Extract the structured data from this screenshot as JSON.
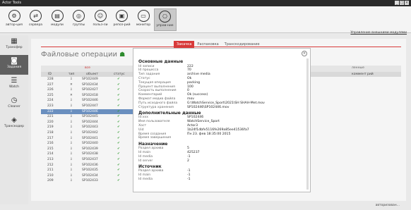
{
  "window": {
    "title": "Actor Tools",
    "controls": [
      "_",
      "□",
      "×"
    ]
  },
  "toolbar": {
    "items": [
      {
        "label": "автор-ция",
        "icon": "wrench-icon",
        "glyph": "⚙"
      },
      {
        "label": "сервера",
        "icon": "server-icon",
        "glyph": "⇄"
      },
      {
        "label": "модули",
        "icon": "modules-icon",
        "glyph": "▤"
      },
      {
        "label": "группы",
        "icon": "groups-icon",
        "glyph": "◎"
      },
      {
        "label": "польз-ли",
        "icon": "users-icon",
        "glyph": "☺"
      },
      {
        "label": "репоз-рий",
        "icon": "repository-icon",
        "glyph": "▣"
      },
      {
        "label": "монитор",
        "icon": "monitor-icon",
        "glyph": "▭"
      },
      {
        "label": "управ-ние",
        "icon": "control-icon",
        "glyph": "⎔"
      }
    ],
    "mgmt_link": "Управление внешними модулями"
  },
  "sidebar": {
    "items": [
      {
        "label": "Трансфер",
        "glyph": "▦"
      },
      {
        "label": "Задания",
        "glyph": "◙"
      },
      {
        "label": "Watch",
        "glyph": "☰"
      },
      {
        "label": "Cleaner",
        "glyph": "◷"
      },
      {
        "label": "Транскодер",
        "glyph": "◈"
      }
    ]
  },
  "main": {
    "title": "Файловые операции",
    "tabs": [
      "Закачка",
      "Распаковка",
      "Транскодирование"
    ],
    "group_head": {
      "left": "все",
      "mid": "ошиб",
      "right": "ленные"
    },
    "columns": [
      "ID",
      "тип",
      "объект",
      "статус"
    ],
    "right_column": "коммент рий",
    "rows": [
      {
        "id": "228",
        "type": "⇩",
        "obj": "SP102449"
      },
      {
        "id": "227",
        "type": "✕",
        "obj": "SP102434"
      },
      {
        "id": "226",
        "type": "⇩",
        "obj": "SP102427"
      },
      {
        "id": "225",
        "type": "✕",
        "obj": "SP102418"
      },
      {
        "id": "224",
        "type": "⇩",
        "obj": "SP102446"
      },
      {
        "id": "223",
        "type": "⇩",
        "obj": "SP102447"
      },
      {
        "id": "222",
        "type": "⇩",
        "obj": "SP102446"
      },
      {
        "id": "221",
        "type": "⇩",
        "obj": "SP102445"
      },
      {
        "id": "220",
        "type": "⇩",
        "obj": "SP102444"
      },
      {
        "id": "219",
        "type": "⇩",
        "obj": "SP102443"
      },
      {
        "id": "218",
        "type": "⇩",
        "obj": "SP102442"
      },
      {
        "id": "217",
        "type": "⇩",
        "obj": "SP102441"
      },
      {
        "id": "216",
        "type": "⇩",
        "obj": "SP102440"
      },
      {
        "id": "215",
        "type": "⇩",
        "obj": "SP102439"
      },
      {
        "id": "214",
        "type": "⇩",
        "obj": "SP102438"
      },
      {
        "id": "213",
        "type": "⇩",
        "obj": "SP102437"
      },
      {
        "id": "212",
        "type": "⇩",
        "obj": "SP102436"
      },
      {
        "id": "211",
        "type": "⇩",
        "obj": "SP102435"
      },
      {
        "id": "210",
        "type": "⇩",
        "obj": "SP102434"
      },
      {
        "id": "209",
        "type": "⇩",
        "obj": "SP102433"
      }
    ],
    "status_check": "✔"
  },
  "dialog": {
    "close": "×",
    "sections": [
      {
        "title": "Основные данные",
        "fields": [
          [
            "Id записи",
            "222"
          ],
          [
            "Id процесса",
            "70"
          ],
          [
            "Тип задания",
            "archive media"
          ],
          [
            "Статус",
            "Ok"
          ],
          [
            "Текущая операция",
            "packing"
          ],
          [
            "Процент выполнения",
            "100"
          ],
          [
            "Скорость выполнения",
            "0"
          ],
          [
            "Комментарий",
            "Ok (success)"
          ],
          [
            "Формат медиа файла",
            "mov"
          ],
          [
            "Путь исходного файла",
            "G:\\WatchService_Sport\\2021\\SH SHAH-Met.mov"
          ],
          [
            "Структура хранения",
            "SP102446\\SP102446.mov"
          ]
        ]
      },
      {
        "title": "Дополнительные данные",
        "fields": [
          [
            "Id:xxx",
            "SP102446"
          ],
          [
            "Имя пользователя",
            "WatchService_Sport"
          ],
          [
            "Хост",
            "Actor3"
          ],
          [
            "Uid",
            "1b24f1dbfe5116fe269a85ee41536fa7"
          ],
          [
            "Время создания",
            "Пн 23. фев 18:35:00 2015"
          ],
          [
            "Время завершения",
            ""
          ]
        ]
      },
      {
        "title": "Назначение",
        "fields": [
          [
            "Раздел архива",
            "5"
          ],
          [
            "Id main",
            "425237"
          ],
          [
            "Id media",
            "-1"
          ],
          [
            "Id server",
            "2"
          ]
        ]
      },
      {
        "title": "Источник",
        "fields": [
          [
            "Раздел архива",
            "-1"
          ],
          [
            "Id main",
            "-1"
          ],
          [
            "Id media",
            "-1"
          ]
        ]
      }
    ]
  },
  "statusbar": "авторизован..."
}
